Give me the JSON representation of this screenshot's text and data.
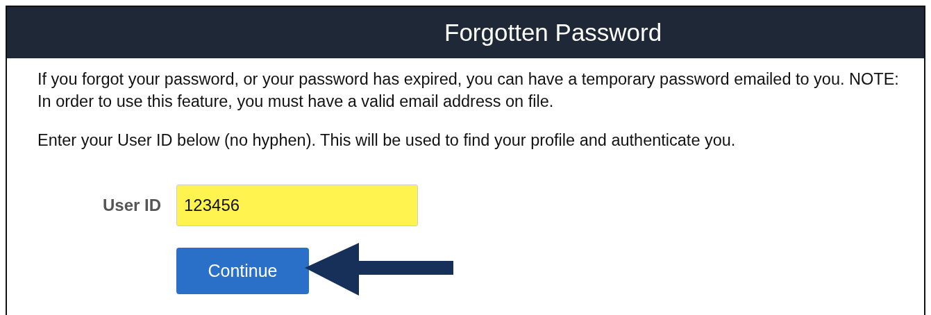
{
  "header": {
    "title": "Forgotten Password"
  },
  "paragraphs": [
    "If you forgot your password, or your password has expired, you can have a temporary password emailed to you. NOTE: In order to use this feature, you must have a valid email address on file.",
    "Enter your User ID below (no hyphen). This will be used to find your profile and authenticate you."
  ],
  "form": {
    "label": "User ID",
    "value": "123456",
    "highlighted": true
  },
  "buttons": [
    "Continue"
  ]
}
